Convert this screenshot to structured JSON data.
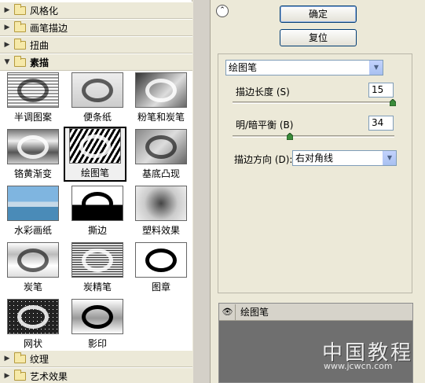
{
  "gallery": {
    "categories": [
      {
        "label": "风格化"
      },
      {
        "label": "画笔描边"
      },
      {
        "label": "扭曲"
      },
      {
        "label": "素描"
      },
      {
        "label": "纹理"
      },
      {
        "label": "艺术效果"
      }
    ],
    "thumbnails": [
      {
        "label": "半调图案"
      },
      {
        "label": "便条纸"
      },
      {
        "label": "粉笔和炭笔"
      },
      {
        "label": "铬黄渐变"
      },
      {
        "label": "绘图笔",
        "selected": true
      },
      {
        "label": "基底凸现"
      },
      {
        "label": "水彩画纸"
      },
      {
        "label": "撕边"
      },
      {
        "label": "塑料效果"
      },
      {
        "label": "炭笔"
      },
      {
        "label": "炭精笔"
      },
      {
        "label": "图章"
      },
      {
        "label": "网状"
      },
      {
        "label": "影印"
      }
    ]
  },
  "buttons": {
    "ok": "确定",
    "reset": "复位"
  },
  "settings": {
    "filter_select": "绘图笔",
    "stroke_length_label": "描边长度 (S)",
    "stroke_length_value": "15",
    "light_dark_label": "明/暗平衡 (B)",
    "light_dark_value": "34",
    "stroke_direction_label": "描边方向 (D):",
    "stroke_direction_value": "右对角线"
  },
  "layers": {
    "name": "绘图笔"
  },
  "watermark": {
    "text": "中国教程",
    "url": "www.jcwcn.com"
  },
  "icons": {
    "collapse": "double-chevron-up-icon",
    "eye": "eye-icon"
  }
}
